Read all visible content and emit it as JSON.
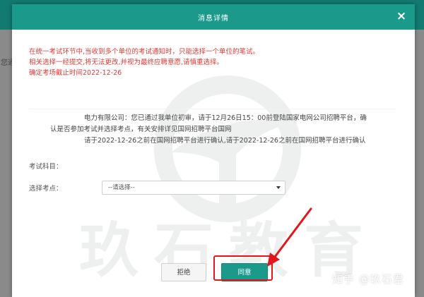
{
  "dialog": {
    "title": "消息详情",
    "close_symbol": "×"
  },
  "background": {
    "left_text": "您通"
  },
  "notice": {
    "lines": [
      "在统一考试环节中,当收到多个单位的考试通知时，只能选择一个单位的笔试。",
      "相关选择一经提交,将无法更改,并视为最终应聘意愿,请慎重选择。",
      "确定考场截止时间2022-12-26"
    ],
    "color": "#e53935"
  },
  "letter": {
    "line1": "电力有限公司：您已通过我单位初审，请于12月26日15：00前登陆国家电网公司招聘平台，确",
    "line2": "认是否参加考试并选择考点，有关安排详见国网招聘平台国网",
    "line3": "请于2022-12-26之前在国网招聘平台进行确认,请于2022-12-26之前在国网招聘平台进行确认"
  },
  "form": {
    "subject_label": "考试科目：",
    "site_label": "选择考点：",
    "site_select_value": "--请选择--"
  },
  "buttons": {
    "reject_label": "拒绝",
    "agree_label": "同意"
  },
  "watermark": {
    "brand_text": "玖石教育",
    "source_text": "知乎 @玖石君"
  },
  "colors": {
    "header": "#1b9a8c",
    "highlight": "#e4161b"
  },
  "icons": {
    "close": "close-icon",
    "select_arrow": "caret-down-icon",
    "logo": "jiushi-logo-icon",
    "annotation": "red-arrow-icon"
  }
}
